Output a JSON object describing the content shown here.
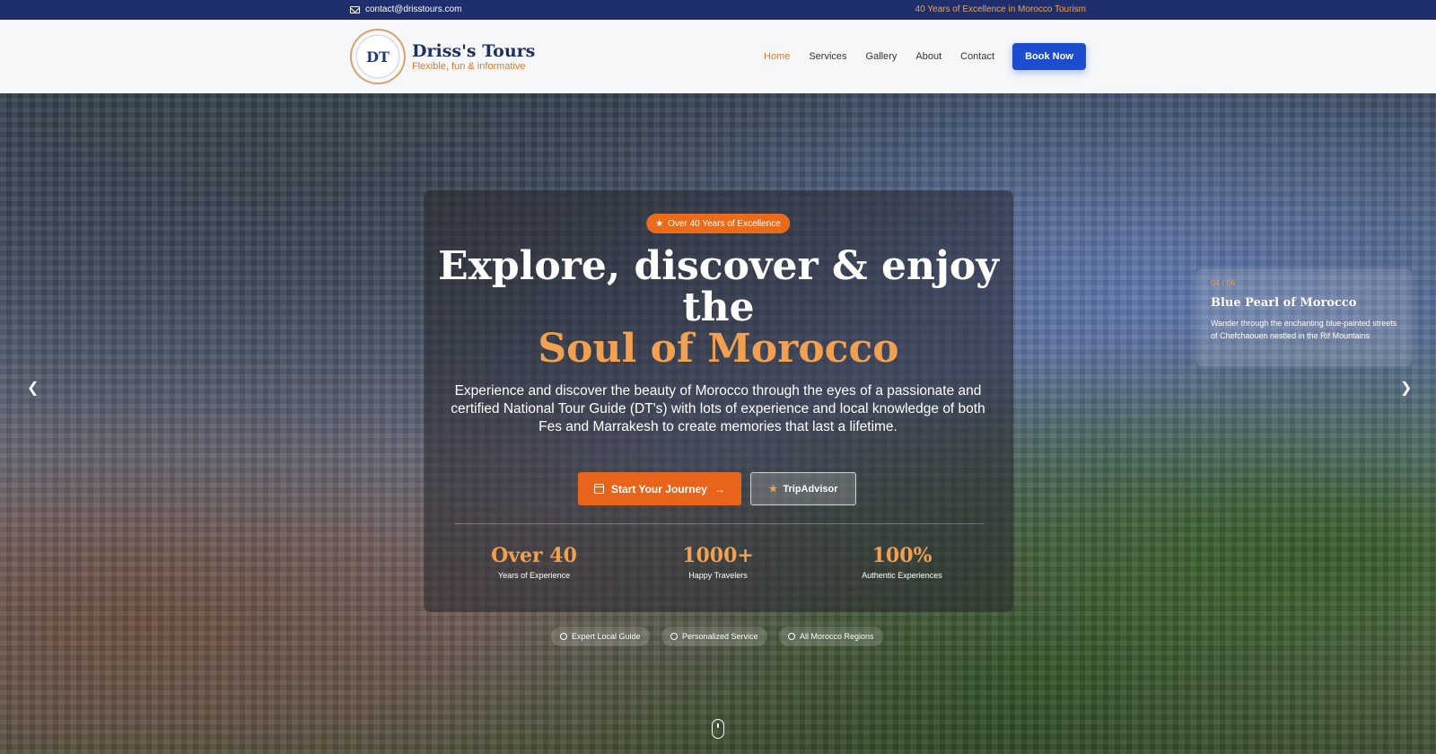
{
  "topbar": {
    "email": "contact@drisstours.com",
    "tagline": "40 Years of Excellence in Morocco Tourism"
  },
  "brand": {
    "logo_text": "DT",
    "name": "Driss's Tours",
    "tagline": "Flexible, fun & informative"
  },
  "nav": {
    "items": [
      {
        "label": "Home",
        "active": true
      },
      {
        "label": "Services"
      },
      {
        "label": "Gallery"
      },
      {
        "label": "About"
      },
      {
        "label": "Contact"
      }
    ],
    "cta": "Book Now"
  },
  "hero": {
    "badge": "Over 40 Years of Excellence",
    "title_line": "Explore, discover & enjoy the",
    "title_accent": "Soul of Morocco",
    "description": "Experience and discover the beauty of Morocco through the eyes of a passionate and certified National Tour Guide (DT's) with lots of experience and local knowledge of both Fes and Marrakesh to create memories that last a lifetime.",
    "primary_button": "Start Your Journey",
    "secondary_button": "TripAdvisor",
    "stats": [
      {
        "value": "Over 40",
        "label": "Years of Experience"
      },
      {
        "value": "1000+",
        "label": "Happy Travelers"
      },
      {
        "value": "100%",
        "label": "Authentic Experiences"
      }
    ],
    "features": [
      "Expert Local Guide",
      "Personalized Service",
      "All Morocco Regions"
    ]
  },
  "slide": {
    "counter": "04 / 06",
    "title": "Blue Pearl of Morocco",
    "description": "Wander through the enchanting blue-painted streets of Chefchaouen nestled in the Rif Mountains"
  },
  "colors": {
    "topbar": "#1f2f6e",
    "accent_orange": "#e8641a",
    "primary_blue": "#1d4dcf"
  },
  "icons": [
    "mail-icon",
    "star-icon",
    "calendar-icon",
    "arrow-right-icon",
    "chevron-left-icon",
    "chevron-right-icon",
    "users-icon",
    "award-icon",
    "map-pin-icon",
    "mouse-icon"
  ]
}
